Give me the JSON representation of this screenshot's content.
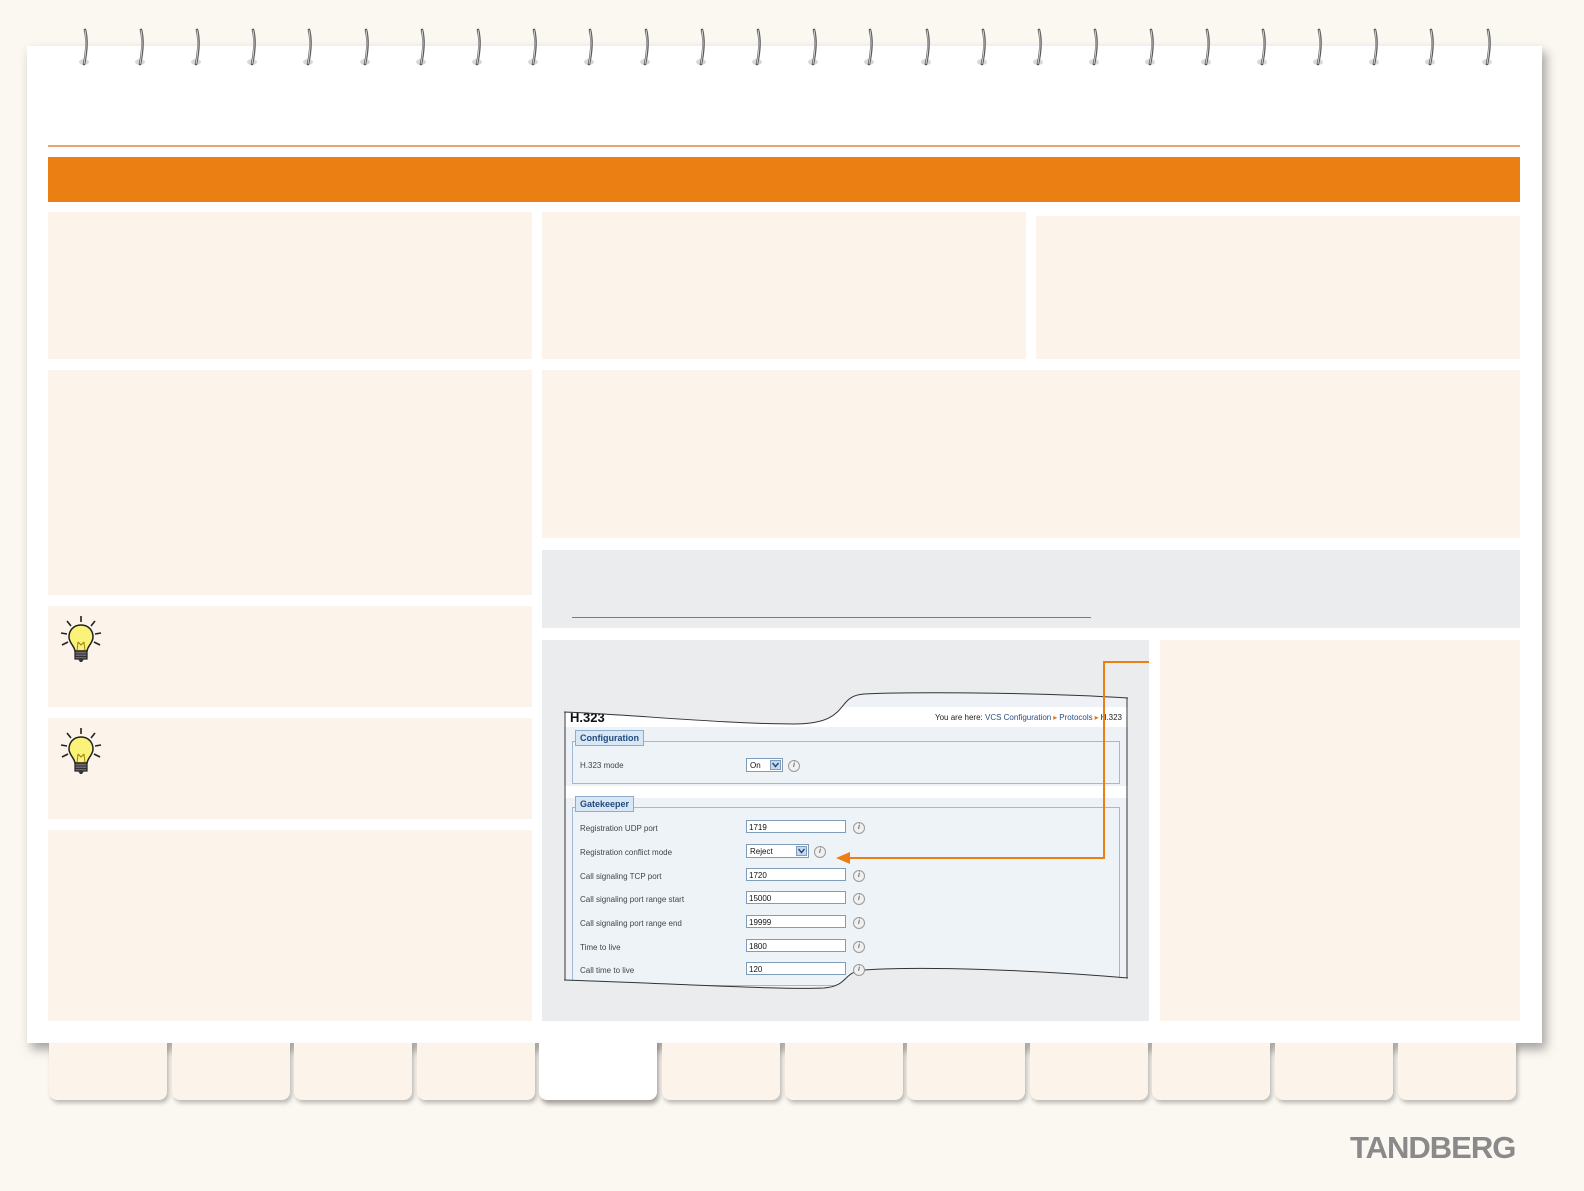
{
  "screenshot": {
    "title": "H.323",
    "breadcrumb": {
      "prefix": "You are here:",
      "items": [
        "VCS Configuration",
        "Protocols",
        "H.323"
      ]
    },
    "configuration": {
      "legend": "Configuration",
      "h323_mode": {
        "label": "H.323 mode",
        "value": "On"
      }
    },
    "gatekeeper": {
      "legend": "Gatekeeper",
      "fields": [
        {
          "label": "Registration UDP port",
          "value": "1719"
        },
        {
          "label": "Registration conflict mode",
          "value": "Reject"
        },
        {
          "label": "Call signaling TCP port",
          "value": "1720"
        },
        {
          "label": "Call signaling port range start",
          "value": "15000"
        },
        {
          "label": "Call signaling port range end",
          "value": "19999"
        },
        {
          "label": "Time to live",
          "value": "1800"
        },
        {
          "label": "Call time to live",
          "value": "120"
        }
      ]
    },
    "info_glyph": "i"
  },
  "icons": {
    "tip": "lightbulb-icon",
    "info": "info-icon",
    "dropdown": "chevron-down-icon"
  },
  "colors": {
    "accent": "#ec7f14",
    "panel": "#fcf3ea",
    "grey_panel": "#ebeced",
    "link": "#2e8fd6"
  },
  "logo": {
    "text": "TANDBERG"
  },
  "tabs": {
    "count": 12,
    "active_index": 4
  }
}
